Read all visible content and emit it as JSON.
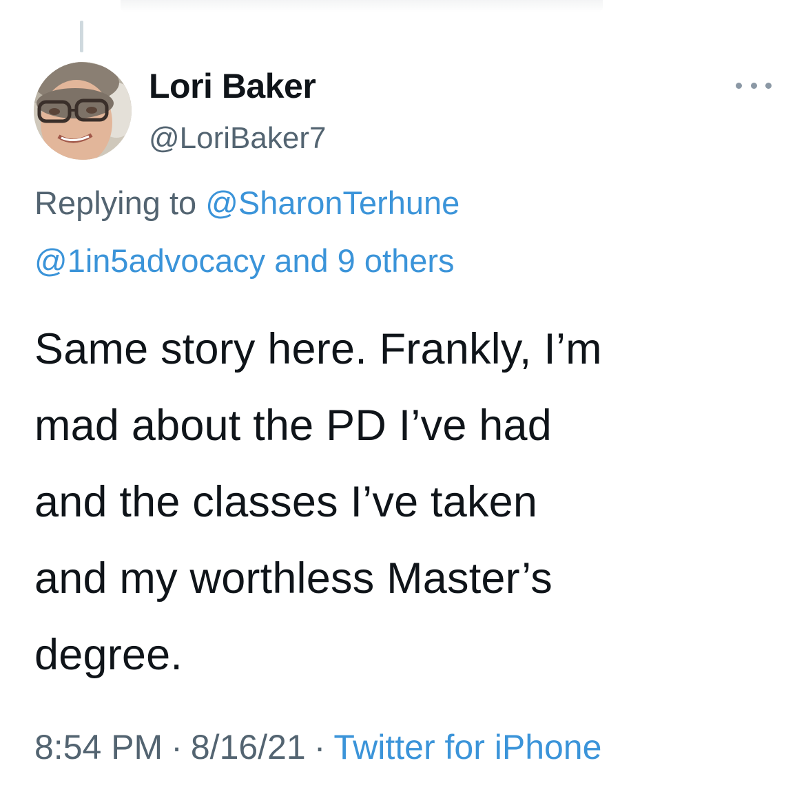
{
  "tweet": {
    "author": {
      "display_name": "Lori Baker",
      "handle": "@LoriBaker7"
    },
    "more_icon": "more-horizontal-icon",
    "reply_context": {
      "prefix": "Replying to",
      "primary_mention": "@SharonTerhune",
      "secondary_mention": "@1in5advocacy",
      "others_text": "and 9 others"
    },
    "body_lines": [
      "Same story here. Frankly, I’m",
      "mad about the PD I’ve had",
      "and the classes I’ve taken",
      "and my worthless Master’s",
      "degree."
    ],
    "meta": {
      "time": "8:54 PM",
      "separator": "·",
      "date": "8/16/21",
      "source": "Twitter for iPhone"
    }
  },
  "colors": {
    "text_primary": "#0f1419",
    "text_secondary": "#536471",
    "link": "#3b94d9",
    "thread_line": "#cfd9de"
  }
}
